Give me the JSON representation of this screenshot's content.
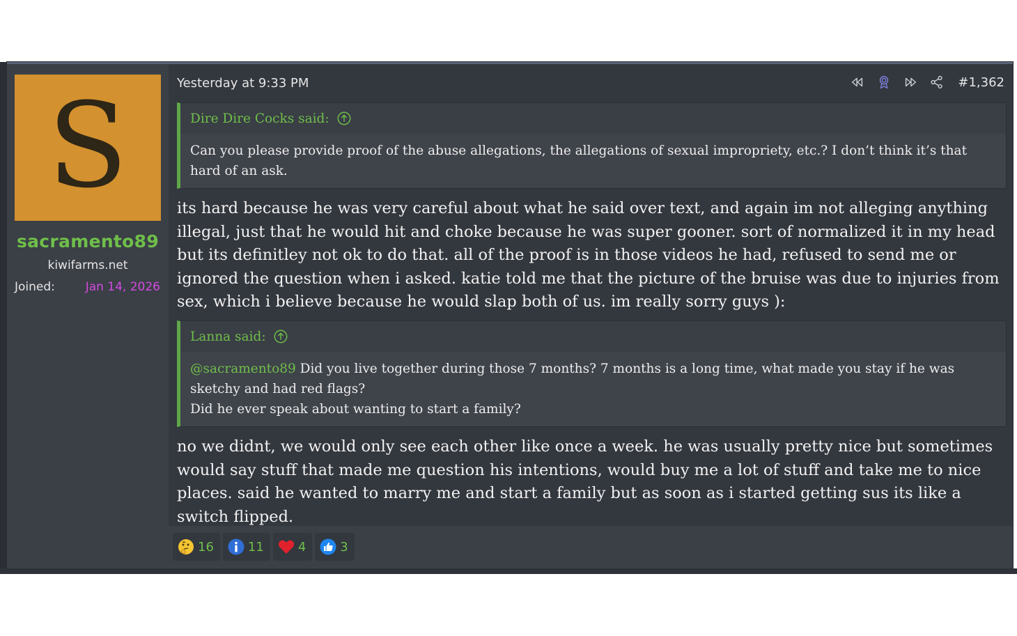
{
  "author": {
    "avatar_letter": "S",
    "avatar_color": "#d4912f",
    "username": "sacramento89",
    "title": "kiwifarms.net",
    "joined_label": "Joined:",
    "joined_value": "Jan 14, 2026"
  },
  "post": {
    "timestamp": "Yesterday at 9:33 PM",
    "number": "#1,362",
    "tools": [
      "rewind-icon",
      "award-icon",
      "fast-forward-icon",
      "share-icon"
    ],
    "quote1": {
      "author": "Dire Dire Cocks said:",
      "text": "Can you please provide proof of the abuse allegations, the allegations of sexual impropriety, etc.? I don’t think it’s that hard of an ask."
    },
    "reply1": "its hard because he was very careful about what he said over text, and again im not alleging anything illegal, just that he would hit and choke because he was super gooner. sort of normalized it in my head but its definitley not ok to do that. all of the proof is in those videos he had, refused to send me or ignored the question when i asked. katie told me that the picture of the bruise was due to injuries from sex, which i believe because he would slap both of us. im really sorry guys ):",
    "quote2": {
      "author": "Lanna said:",
      "mention": "@sacramento89",
      "line1": " Did you live together during those 7 months? 7 months is a long time, what made you stay if he was sketchy and had red flags?",
      "line2": "Did he ever speak about wanting to start a family?"
    },
    "reply2": "no we didnt, we would only see each other like once a week. he was usually pretty nice but sometimes would say stuff that made me question his intentions, would buy me a lot of stuff and take me to nice places. said he wanted to marry me and start a family but as soon as i started getting sus its like a switch flipped."
  },
  "reactions": [
    {
      "icon": "thinking-emoji-icon",
      "count": "16"
    },
    {
      "icon": "informative-icon",
      "count": "11"
    },
    {
      "icon": "heart-icon",
      "count": "4"
    },
    {
      "icon": "thumbs-up-icon",
      "count": "3"
    }
  ],
  "colors": {
    "accent_green": "#6fbf4a",
    "joined_pink": "#d24be0",
    "post_bg": "#33373e"
  }
}
